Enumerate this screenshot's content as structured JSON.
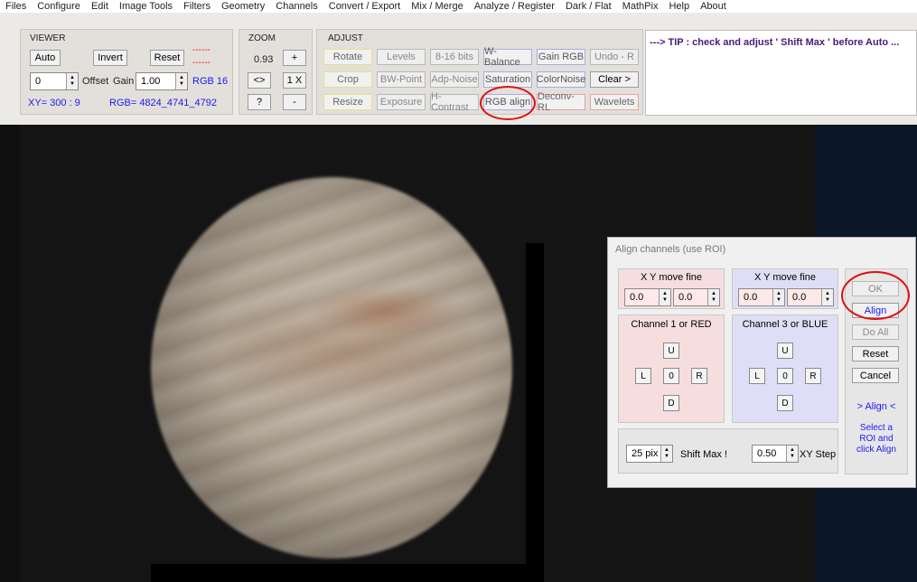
{
  "menu": [
    "Files",
    "Configure",
    "Edit",
    "Image Tools",
    "Filters",
    "Geometry",
    "Channels",
    "Convert / Export",
    "Mix / Merge",
    "Analyze / Register",
    "Dark / Flat",
    "MathPix",
    "Help",
    "About"
  ],
  "viewer_panel": {
    "title": "VIEWER",
    "auto": "Auto",
    "invent": "Invert",
    "reset": "Reset",
    "dashes1": "------",
    "dashes2": "------",
    "offset_value": "0",
    "offset_label": "Offset",
    "gain_label": "Gain",
    "gain_value": "1.00",
    "rgb_mode": "RGB 16",
    "xy": "XY=  300 : 9",
    "rgb": "RGB=  4824_4741_4792"
  },
  "zoom_panel": {
    "title": "ZOOM",
    "value": "0.93",
    "plus": "+",
    "fit": "<>",
    "one": "1 X",
    "help": "?",
    "minus": "-"
  },
  "adjust_panel": {
    "title": "ADJUST",
    "row1": [
      "Rotate",
      "Levels",
      "8-16 bits",
      "W-Balance",
      "Gain RGB",
      "Undo - R"
    ],
    "row2": [
      "Crop",
      "BW-Point",
      "Adp-Noise",
      "Saturation",
      "ColorNoise",
      "Clear >"
    ],
    "row3": [
      "Resize",
      "Exposure",
      "H-Contrast",
      "RGB align",
      "Deconv-RL",
      "Wavelets"
    ]
  },
  "tip": "---> TIP :  check and adjust ' Shift Max ' before Auto ...",
  "dialog": {
    "title": "Align channels (use ROI)",
    "red_move_label": "X  Y  move fine",
    "blue_move_label": "X  Y  move fine",
    "red_x": "0.0",
    "red_y": "0.0",
    "blue_x": "0.0",
    "blue_y": "0.0",
    "red_channel": "Channel 1 or RED",
    "blue_channel": "Channel 3 or BLUE",
    "u": "U",
    "l": "L",
    "zero": "0",
    "r": "R",
    "d": "D",
    "shift_value": "25 pix",
    "shift_label": "Shift Max !",
    "step_value": "0.50",
    "step_label": "XY Step",
    "ok": "OK",
    "align": "Align",
    "do_all": "Do All",
    "reset": "Reset",
    "cancel": "Cancel",
    "align_header": "> Align <",
    "hint": "Select a ROI and click Align"
  },
  "colors": {
    "annotation": "#e01010",
    "accent_blue": "#1a1af0"
  }
}
